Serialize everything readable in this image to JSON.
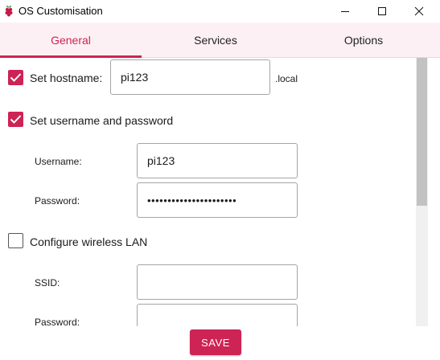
{
  "window": {
    "title": "OS Customisation",
    "app_icon": "raspberry-icon"
  },
  "tabs": [
    {
      "label": "General",
      "active": true
    },
    {
      "label": "Services",
      "active": false
    },
    {
      "label": "Options",
      "active": false
    }
  ],
  "general": {
    "hostname": {
      "checkbox_label": "Set hostname:",
      "checked": true,
      "value": "pi123",
      "suffix": ".local"
    },
    "user": {
      "checkbox_label": "Set username and password",
      "checked": true,
      "username_label": "Username:",
      "username_value": "pi123",
      "password_label": "Password:",
      "password_value": "••••••••••••••••••••••"
    },
    "wlan": {
      "checkbox_label": "Configure wireless LAN",
      "checked": false,
      "ssid_label": "SSID:",
      "ssid_value": "",
      "password_label": "Password:",
      "password_value": ""
    }
  },
  "footer": {
    "save_label": "SAVE"
  },
  "colors": {
    "accent": "#cd2355",
    "tabbar_bg": "#fdf0f4"
  }
}
